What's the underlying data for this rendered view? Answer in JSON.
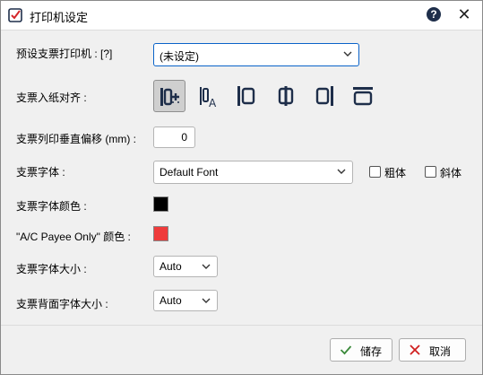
{
  "window": {
    "title": "打印机设定",
    "help_label": "?",
    "close_label": "✕"
  },
  "form": {
    "printer": {
      "label": "预设支票打印机 : [?]",
      "value": "(未设定)"
    },
    "feed_align": {
      "label": "支票入纸对齐 :",
      "options": [
        "left-feed-selected",
        "left-feed-text",
        "left-edge",
        "center",
        "right-edge",
        "top-edge"
      ],
      "selected_index": 0
    },
    "vertical_offset": {
      "label": "支票列印垂直偏移 (mm) :",
      "value": "0"
    },
    "font": {
      "label": "支票字体 :",
      "value": "Default Font",
      "bold_label": "粗体",
      "italic_label": "斜体",
      "bold_checked": false,
      "italic_checked": false
    },
    "font_color": {
      "label": "支票字体颜色 :",
      "color": "#000000"
    },
    "payee_color": {
      "label": "\"A/C Payee Only\" 颜色 :",
      "color": "#ef3b3b"
    },
    "font_size": {
      "label": "支票字体大小 :",
      "value": "Auto"
    },
    "back_font_size": {
      "label": "支票背面字体大小 :",
      "value": "Auto"
    }
  },
  "footer": {
    "save_label": "储存",
    "cancel_label": "取消"
  },
  "colors": {
    "accent": "#0a63c9",
    "save_check": "#3b8a3b",
    "cancel_x": "#d02020",
    "icon": "#1e2e4a"
  }
}
